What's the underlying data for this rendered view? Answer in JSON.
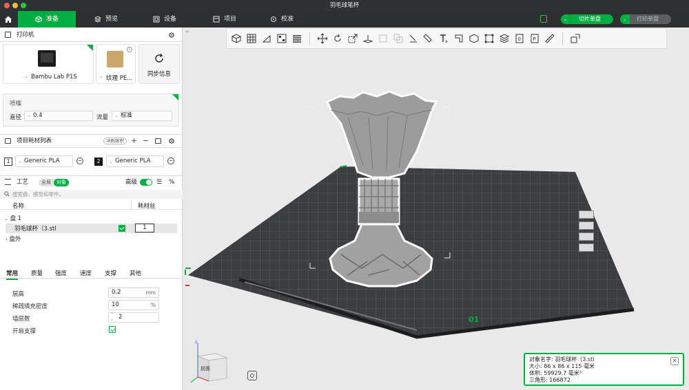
{
  "window_title": "羽毛球笔杯",
  "tabs": [
    {
      "label": "准备",
      "active": true
    },
    {
      "label": "预览"
    },
    {
      "label": "设备"
    },
    {
      "label": "项目"
    },
    {
      "label": "校准"
    }
  ],
  "actions": {
    "slice_label": "切片单盘",
    "print_label": "打印单盘"
  },
  "printer": {
    "section_title": "打印机",
    "model": "Bambu Lab P1S",
    "plate": "纹理 PE...",
    "sync_label": "同步信息",
    "nozzle_title": "喷嘴",
    "diameter_label": "直径",
    "diameter_value": "0.4",
    "flow_label": "流量",
    "flow_value": "标准"
  },
  "filament": {
    "section_title": "项目耗材列表",
    "flush_label": "冲刷体积",
    "slots": [
      {
        "num": "1",
        "name": "Generic PLA"
      },
      {
        "num": "2",
        "name": "Generic PLA"
      }
    ]
  },
  "process": {
    "section_title": "工艺",
    "toggle_global": "全局",
    "toggle_object": "对象",
    "advanced_label": "高级",
    "search_placeholder": "搜索盘、模型和零件。",
    "col_name": "名称",
    "col_filament": "耗材丝",
    "tree": {
      "plate": "盘 1",
      "object": "羽毛球杯（3.stl",
      "object_filament": "1",
      "outside": "盘外"
    },
    "setting_tabs": [
      "常用",
      "质量",
      "强度",
      "速度",
      "支撑",
      "其他"
    ],
    "settings": [
      {
        "label": "层高",
        "value": "0.2",
        "unit": "mm"
      },
      {
        "label": "稀疏填充密度",
        "value": "10",
        "unit": "%"
      },
      {
        "label": "墙层数",
        "value": "2",
        "unit": ""
      },
      {
        "label": "开启支撑",
        "value": "",
        "unit": ""
      }
    ]
  },
  "viewport": {
    "plate_number": "01",
    "cube_front": "前面",
    "info": {
      "name_label": "对象名字:",
      "name_value": "羽毛球杯（3.stl",
      "size_label": "大小:",
      "size_value": "86 x 86 x 115 毫米",
      "volume_label": "体积:",
      "volume_value": "59929.7 毫米³",
      "tri_label": "三角形:",
      "tri_value": "166872"
    }
  },
  "colors": {
    "accent": "#00ae42",
    "topbar": "#2d2f30",
    "bed": "#3b3d40"
  },
  "icons": [
    "home-icon",
    "cube-icon",
    "preview-icon",
    "device-icon",
    "project-icon",
    "calibrate-icon",
    "gear-icon",
    "sync-icon",
    "plus-icon",
    "minus-icon",
    "info-icon"
  ]
}
